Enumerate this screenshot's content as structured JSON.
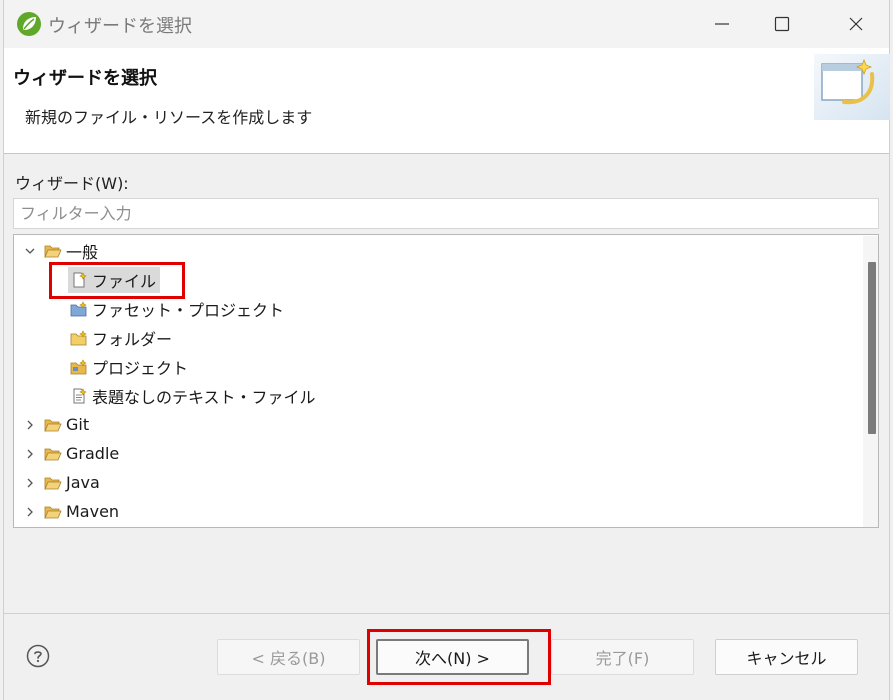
{
  "window": {
    "title": "ウィザードを選択"
  },
  "header": {
    "title": "ウィザードを選択",
    "description": "新規のファイル・リソースを作成します"
  },
  "wizard_list": {
    "label": "ウィザード(W):",
    "filter_placeholder": "フィルター入力",
    "filter_value": "",
    "tree": [
      {
        "label": "一般",
        "expanded": true,
        "children": [
          {
            "label": "ファイル",
            "icon": "file-new-icon",
            "selected": true
          },
          {
            "label": "ファセット・プロジェクト",
            "icon": "faceted-project-icon"
          },
          {
            "label": "フォルダー",
            "icon": "folder-new-icon"
          },
          {
            "label": "プロジェクト",
            "icon": "project-new-icon"
          },
          {
            "label": "表題なしのテキスト・ファイル",
            "icon": "text-file-icon"
          }
        ]
      },
      {
        "label": "Git",
        "expanded": false
      },
      {
        "label": "Gradle",
        "expanded": false
      },
      {
        "label": "Java",
        "expanded": false
      },
      {
        "label": "Maven",
        "expanded": false
      }
    ]
  },
  "buttons": {
    "back": "< 戻る(B)",
    "next": "次へ(N) >",
    "finish": "完了(F)",
    "cancel": "キャンセル"
  },
  "colors": {
    "highlight": "#e00000",
    "folder": "#e8b84a",
    "selection": "#dadada"
  }
}
